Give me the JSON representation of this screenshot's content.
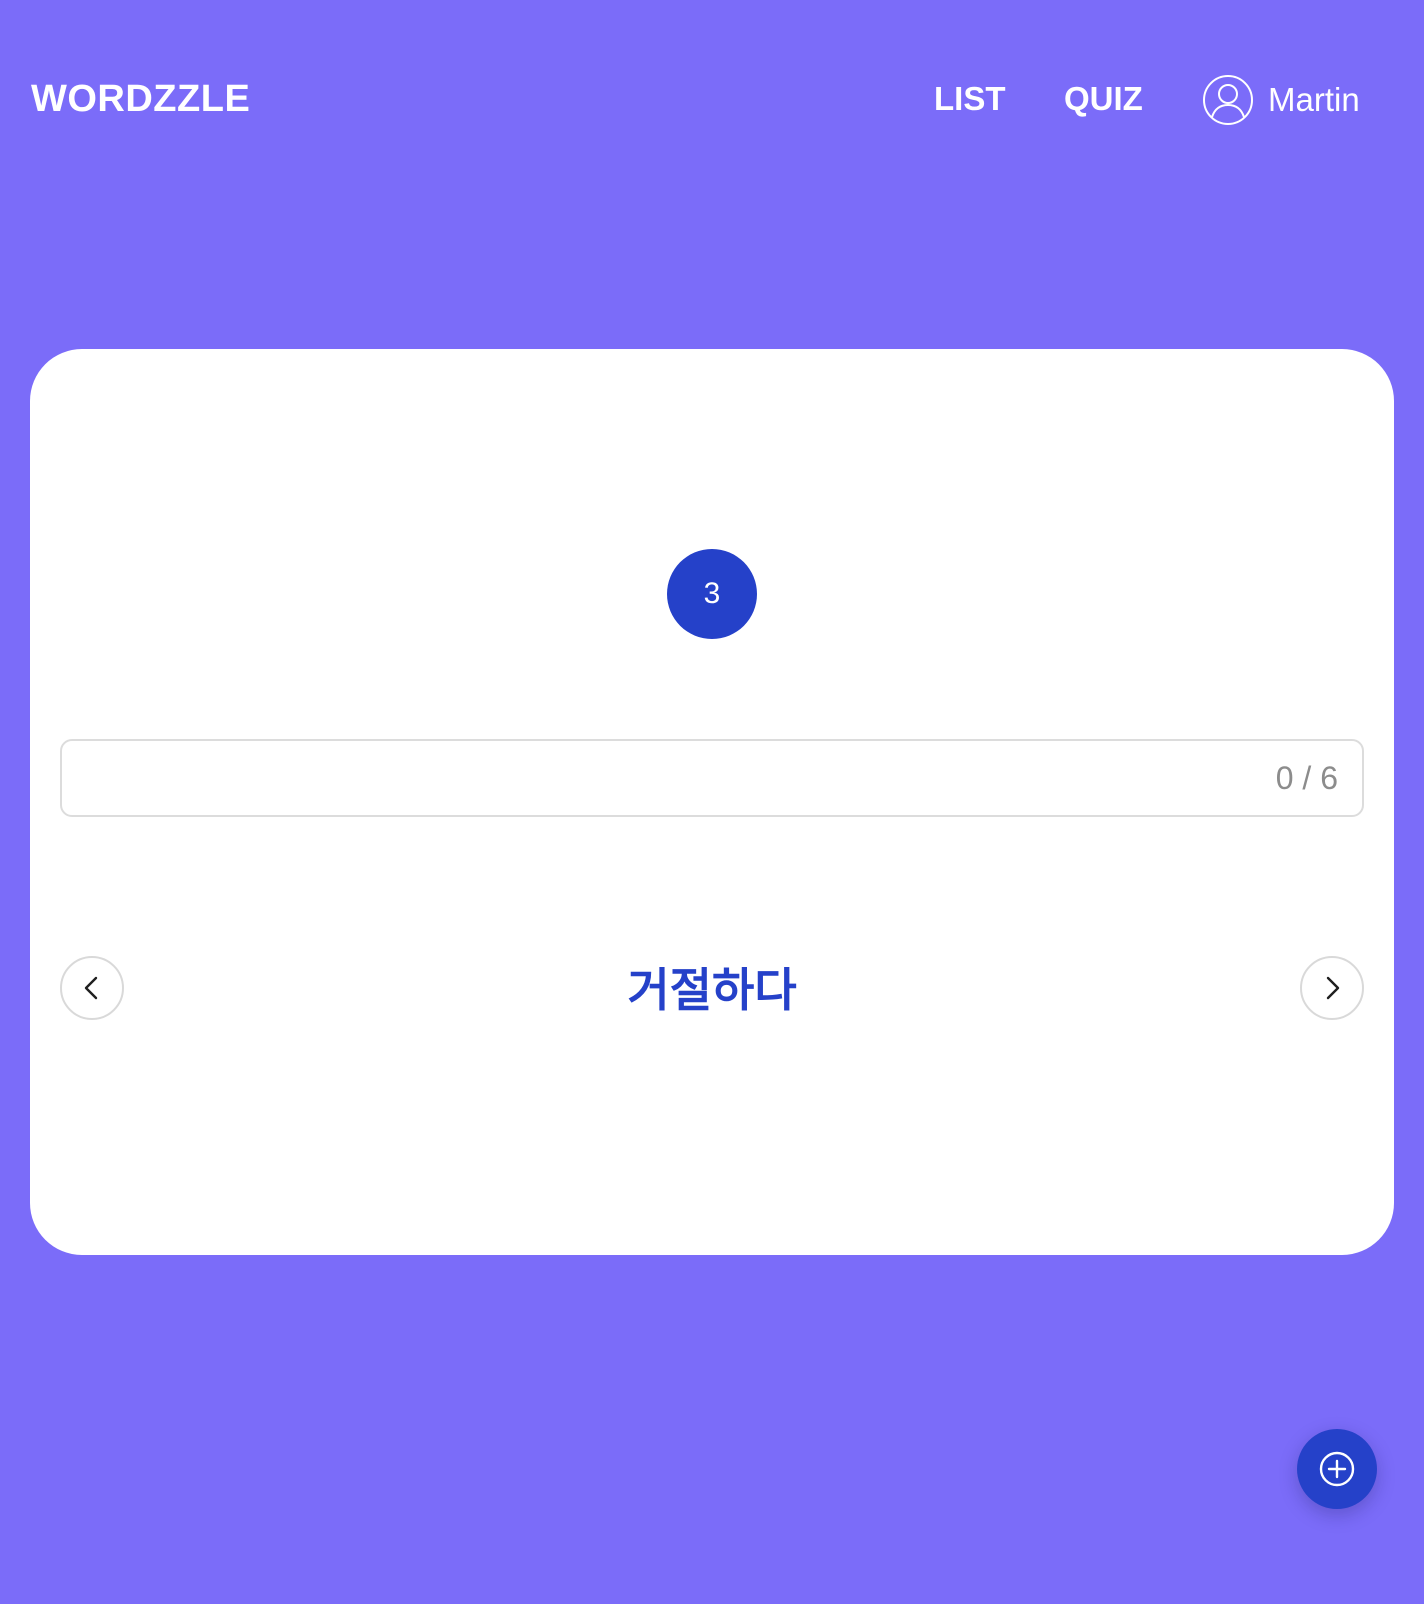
{
  "header": {
    "logo": "WORDZZLE",
    "nav": {
      "list_label": "LIST",
      "quiz_label": "QUIZ"
    },
    "user": {
      "icon": "user-circle-icon",
      "name": "Martin"
    }
  },
  "card": {
    "step_number": "3",
    "answer": {
      "value": "",
      "count_text": "0 / 6"
    },
    "word": "거절하다",
    "prev_icon": "chevron-left-icon",
    "next_icon": "chevron-right-icon"
  },
  "fab": {
    "icon": "plus-circle-icon"
  },
  "colors": {
    "background": "#7b6cf9",
    "accent": "#2541c9",
    "card": "#ffffff"
  }
}
